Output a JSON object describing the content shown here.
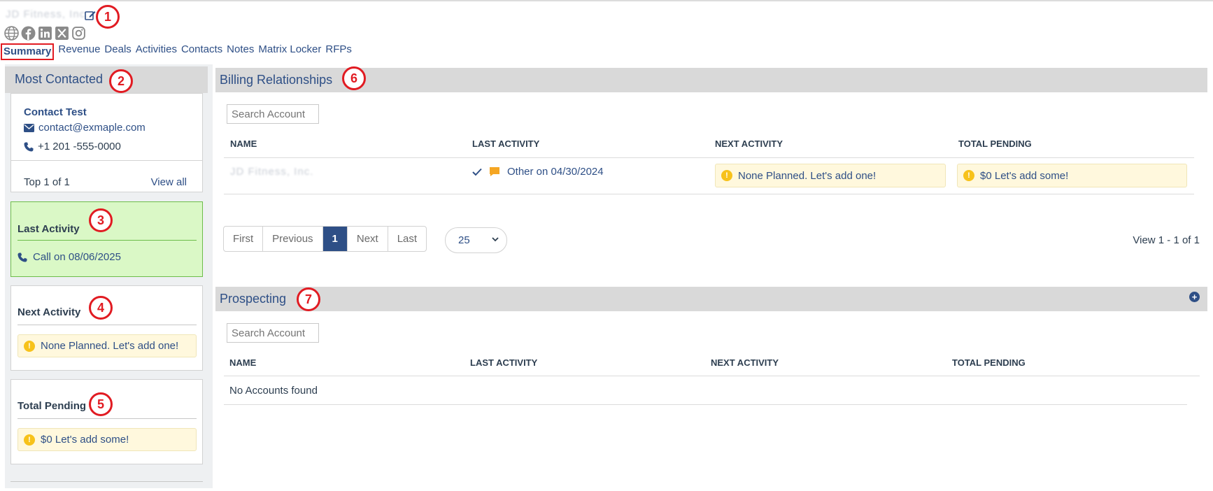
{
  "header": {
    "account_name": "JD Fitness, Inc.",
    "socials": [
      "globe-icon",
      "facebook-icon",
      "linkedin-icon",
      "x-twitter-icon",
      "instagram-icon"
    ]
  },
  "nav": {
    "tabs": [
      "Summary",
      "Revenue",
      "Deals",
      "Activities",
      "Contacts",
      "Notes",
      "Matrix Locker",
      "RFPs"
    ],
    "active": "Summary"
  },
  "callouts": [
    "1",
    "2",
    "3",
    "4",
    "5",
    "6",
    "7"
  ],
  "most_contacted": {
    "title": "Most Contacted",
    "contact_name": "Contact Test",
    "email": "contact@exmaple.com",
    "phone": "+1 201 -555-0000",
    "count_text": "Top 1 of 1",
    "view_all": "View all"
  },
  "last_activity": {
    "title": "Last Activity",
    "value": "Call on 08/06/2025"
  },
  "next_activity": {
    "title": "Next Activity",
    "value": "None Planned. Let's add one!"
  },
  "total_pending": {
    "title": "Total Pending",
    "value": "$0 Let's add some!"
  },
  "billing": {
    "title": "Billing Relationships",
    "search_placeholder": "Search Account",
    "columns": [
      "NAME",
      "LAST ACTIVITY",
      "NEXT ACTIVITY",
      "TOTAL PENDING"
    ],
    "rows": [
      {
        "name": "JD Fitness, Inc.",
        "last_activity": "Other on 04/30/2024",
        "next_activity": "None Planned. Let's add one!",
        "total_pending": "$0 Let's add some!"
      }
    ],
    "pager": [
      "First",
      "Previous",
      "1",
      "Next",
      "Last"
    ],
    "page_size": "25",
    "view_info": "View 1 - 1 of 1"
  },
  "prospecting": {
    "title": "Prospecting",
    "search_placeholder": "Search Account",
    "columns": [
      "NAME",
      "LAST ACTIVITY",
      "NEXT ACTIVITY",
      "TOTAL PENDING"
    ],
    "empty": "No Accounts found"
  },
  "colors": {
    "brand": "#2e4f86",
    "callout": "#e11b22",
    "success_bg": "#daf8c6",
    "warn_bg": "#fff8dd",
    "warn_icon": "#f7c21b"
  }
}
